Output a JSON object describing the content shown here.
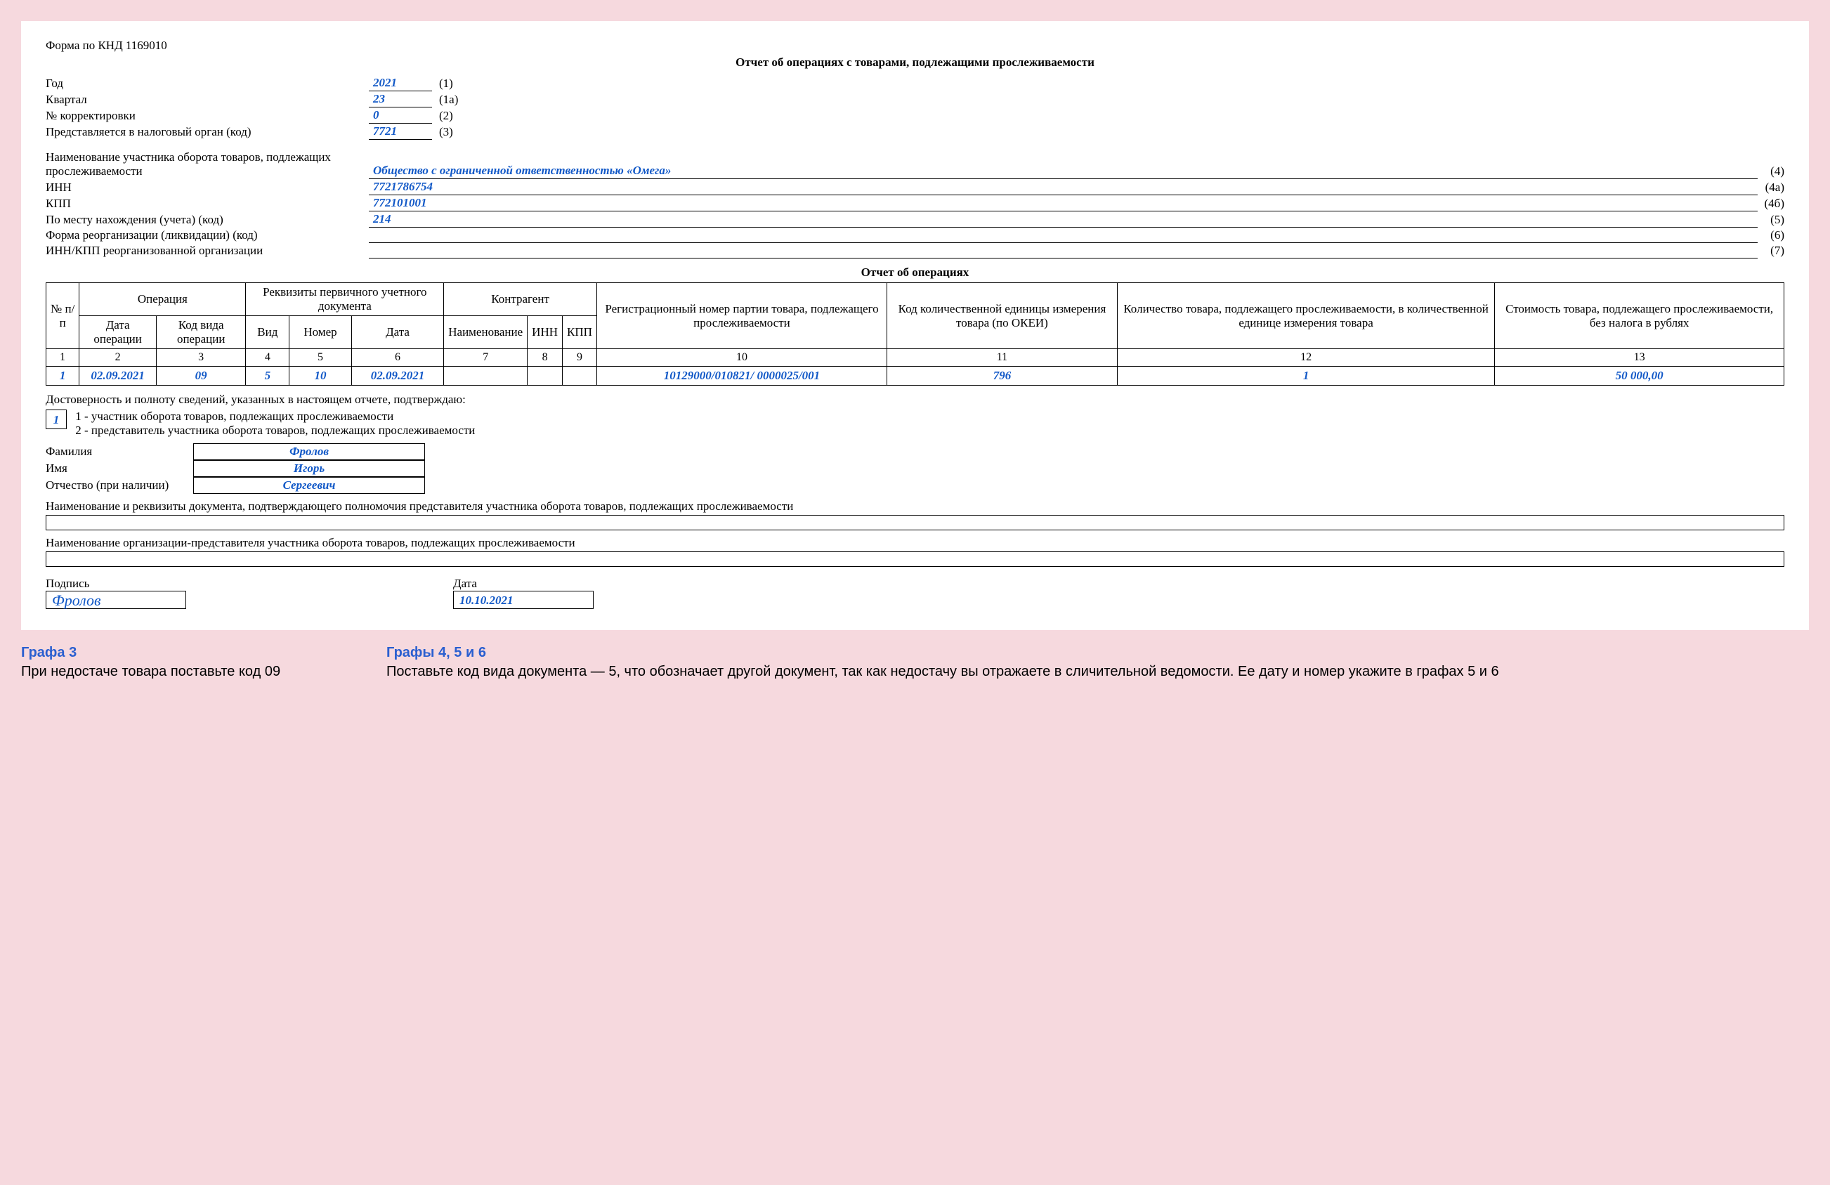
{
  "form_code": "Форма по КНД 1169010",
  "title": "Отчет об операциях с товарами, подлежащими прослеживаемости",
  "header": {
    "year": {
      "label": "Год",
      "value": "2021",
      "num": "(1)"
    },
    "quarter": {
      "label": "Квартал",
      "value": "23",
      "num": "(1а)"
    },
    "correction": {
      "label": "№ корректировки",
      "value": "0",
      "num": "(2)"
    },
    "tax_auth": {
      "label": "Представляется в налоговый орган (код)",
      "value": "7721",
      "num": "(3)"
    }
  },
  "long": {
    "name": {
      "label": "Наименование участника оборота товаров, подлежащих прослеживаемости",
      "value": "Общество с ограниченной ответственностью «Омега»",
      "num": "(4)"
    },
    "inn": {
      "label": "ИНН",
      "value": "7721786754",
      "num": "(4а)"
    },
    "kpp": {
      "label": "КПП",
      "value": "772101001",
      "num": "(4б)"
    },
    "loc": {
      "label": "По месту нахождения (учета) (код)",
      "value": "214",
      "num": "(5)"
    },
    "reorg_form": {
      "label": "Форма реорганизации (ликвидации) (код)",
      "value": "",
      "num": "(6)"
    },
    "reorg_inn_kpp": {
      "label": "ИНН/КПП реорганизованной организации",
      "value": "",
      "num": "(7)"
    }
  },
  "subtitle": "Отчет об операциях",
  "table": {
    "h_num": "№ п/п",
    "h_op": "Операция",
    "h_doc": "Реквизиты первичного учетного документа",
    "h_contr": "Контрагент",
    "h_reg": "Регистрационный номер партии товара, подлежащего прослеживаемости",
    "h_okei": "Код коли­чественной единицы измерения товара (по ОКЕИ)",
    "h_qty": "Количество товара, подлежащего прослеживаемости, в количественной еди­нице измерения товара",
    "h_cost": "Стоимость товара, подлежащего прослеживаемости, без налога в рублях",
    "h_op_date": "Дата операции",
    "h_op_code": "Код вида операции",
    "h_doc_type": "Вид",
    "h_doc_num": "Номер",
    "h_doc_date": "Дата",
    "h_c_name": "Наименование",
    "h_c_inn": "ИНН",
    "h_c_kpp": "КПП",
    "cols": {
      "c1": "1",
      "c2": "2",
      "c3": "3",
      "c4": "4",
      "c5": "5",
      "c6": "6",
      "c7": "7",
      "c8": "8",
      "c9": "9",
      "c10": "10",
      "c11": "11",
      "c12": "12",
      "c13": "13"
    },
    "row": {
      "n": "1",
      "op_date": "02.09.2021",
      "op_code": "09",
      "doc_type": "5",
      "doc_num": "10",
      "doc_date": "02.09.2021",
      "c_name": "",
      "c_inn": "",
      "c_kpp": "",
      "reg": "10129000/010821/ 0000025/001",
      "okei": "796",
      "qty": "1",
      "cost": "50 000,00"
    }
  },
  "confirm": {
    "text": "Достоверность и полноту сведений, указанных в настоящем отчете, подтверждаю:",
    "code": "1",
    "line1": "1 - участник оборота товаров, подлежащих прослеживаемости",
    "line2": "2 - представитель участника оборота товаров, подлежащих прослеживаемости"
  },
  "fio": {
    "surname": {
      "label": "Фамилия",
      "value": "Фролов"
    },
    "name": {
      "label": "Имя",
      "value": "Игорь"
    },
    "patronymic": {
      "label": "Отчество (при наличии)",
      "value": "Сергеевич"
    }
  },
  "auth1": "Наименование и реквизиты документа, подтверждающего полномочия представителя участника оборота товаров, подлежащих прослеживаемости",
  "auth2": "Наименование организации-представителя участника оборота товаров, подлежащих прослеживаемости",
  "sign": {
    "label": "Подпись",
    "value": "Фролов"
  },
  "date": {
    "label": "Дата",
    "value": "10.10.2021"
  },
  "notes": {
    "n1": {
      "title": "Графа 3",
      "body": "При недостаче товара поставьте код 09"
    },
    "n2": {
      "title": "Графы 4, 5 и 6",
      "body": "Поставьте код вида документа — 5, что обозначает другой документ, так как недостачу вы отражаете в сличительной ведомости. Ее дату и номер укажите в графах 5 и 6"
    }
  }
}
